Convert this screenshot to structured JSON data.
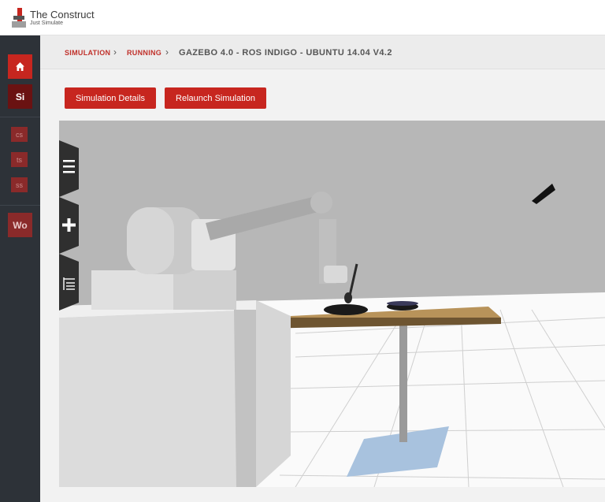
{
  "app": {
    "title": "The Construct",
    "subtitle": "Just Simulate"
  },
  "sidebar": {
    "home_icon": "home-icon",
    "items": [
      {
        "label": "Si",
        "color": "#6a1212"
      },
      {
        "label": "cs",
        "color": "#8a2a2a"
      },
      {
        "label": "ts",
        "color": "#8a2a2a"
      },
      {
        "label": "ss",
        "color": "#8a2a2a"
      },
      {
        "label": "Wo",
        "color": "#8a2a2a"
      }
    ]
  },
  "breadcrumb": {
    "items": [
      "SIMULATION",
      "RUNNING"
    ],
    "current": "GAZEBO 4.0 - ROS INDIGO - UBUNTU 14.04 V4.2",
    "separator": "›"
  },
  "actions": {
    "details_label": "Simulation Details",
    "relaunch_label": "Relaunch Simulation"
  },
  "viewer": {
    "tools": [
      "menu-icon",
      "plus-icon",
      "tree-icon"
    ]
  },
  "colors": {
    "accent": "#c7261f",
    "sidebar": "#2d3238",
    "scene_wall": "#b7b7b7",
    "table_top": "#b8935a"
  }
}
